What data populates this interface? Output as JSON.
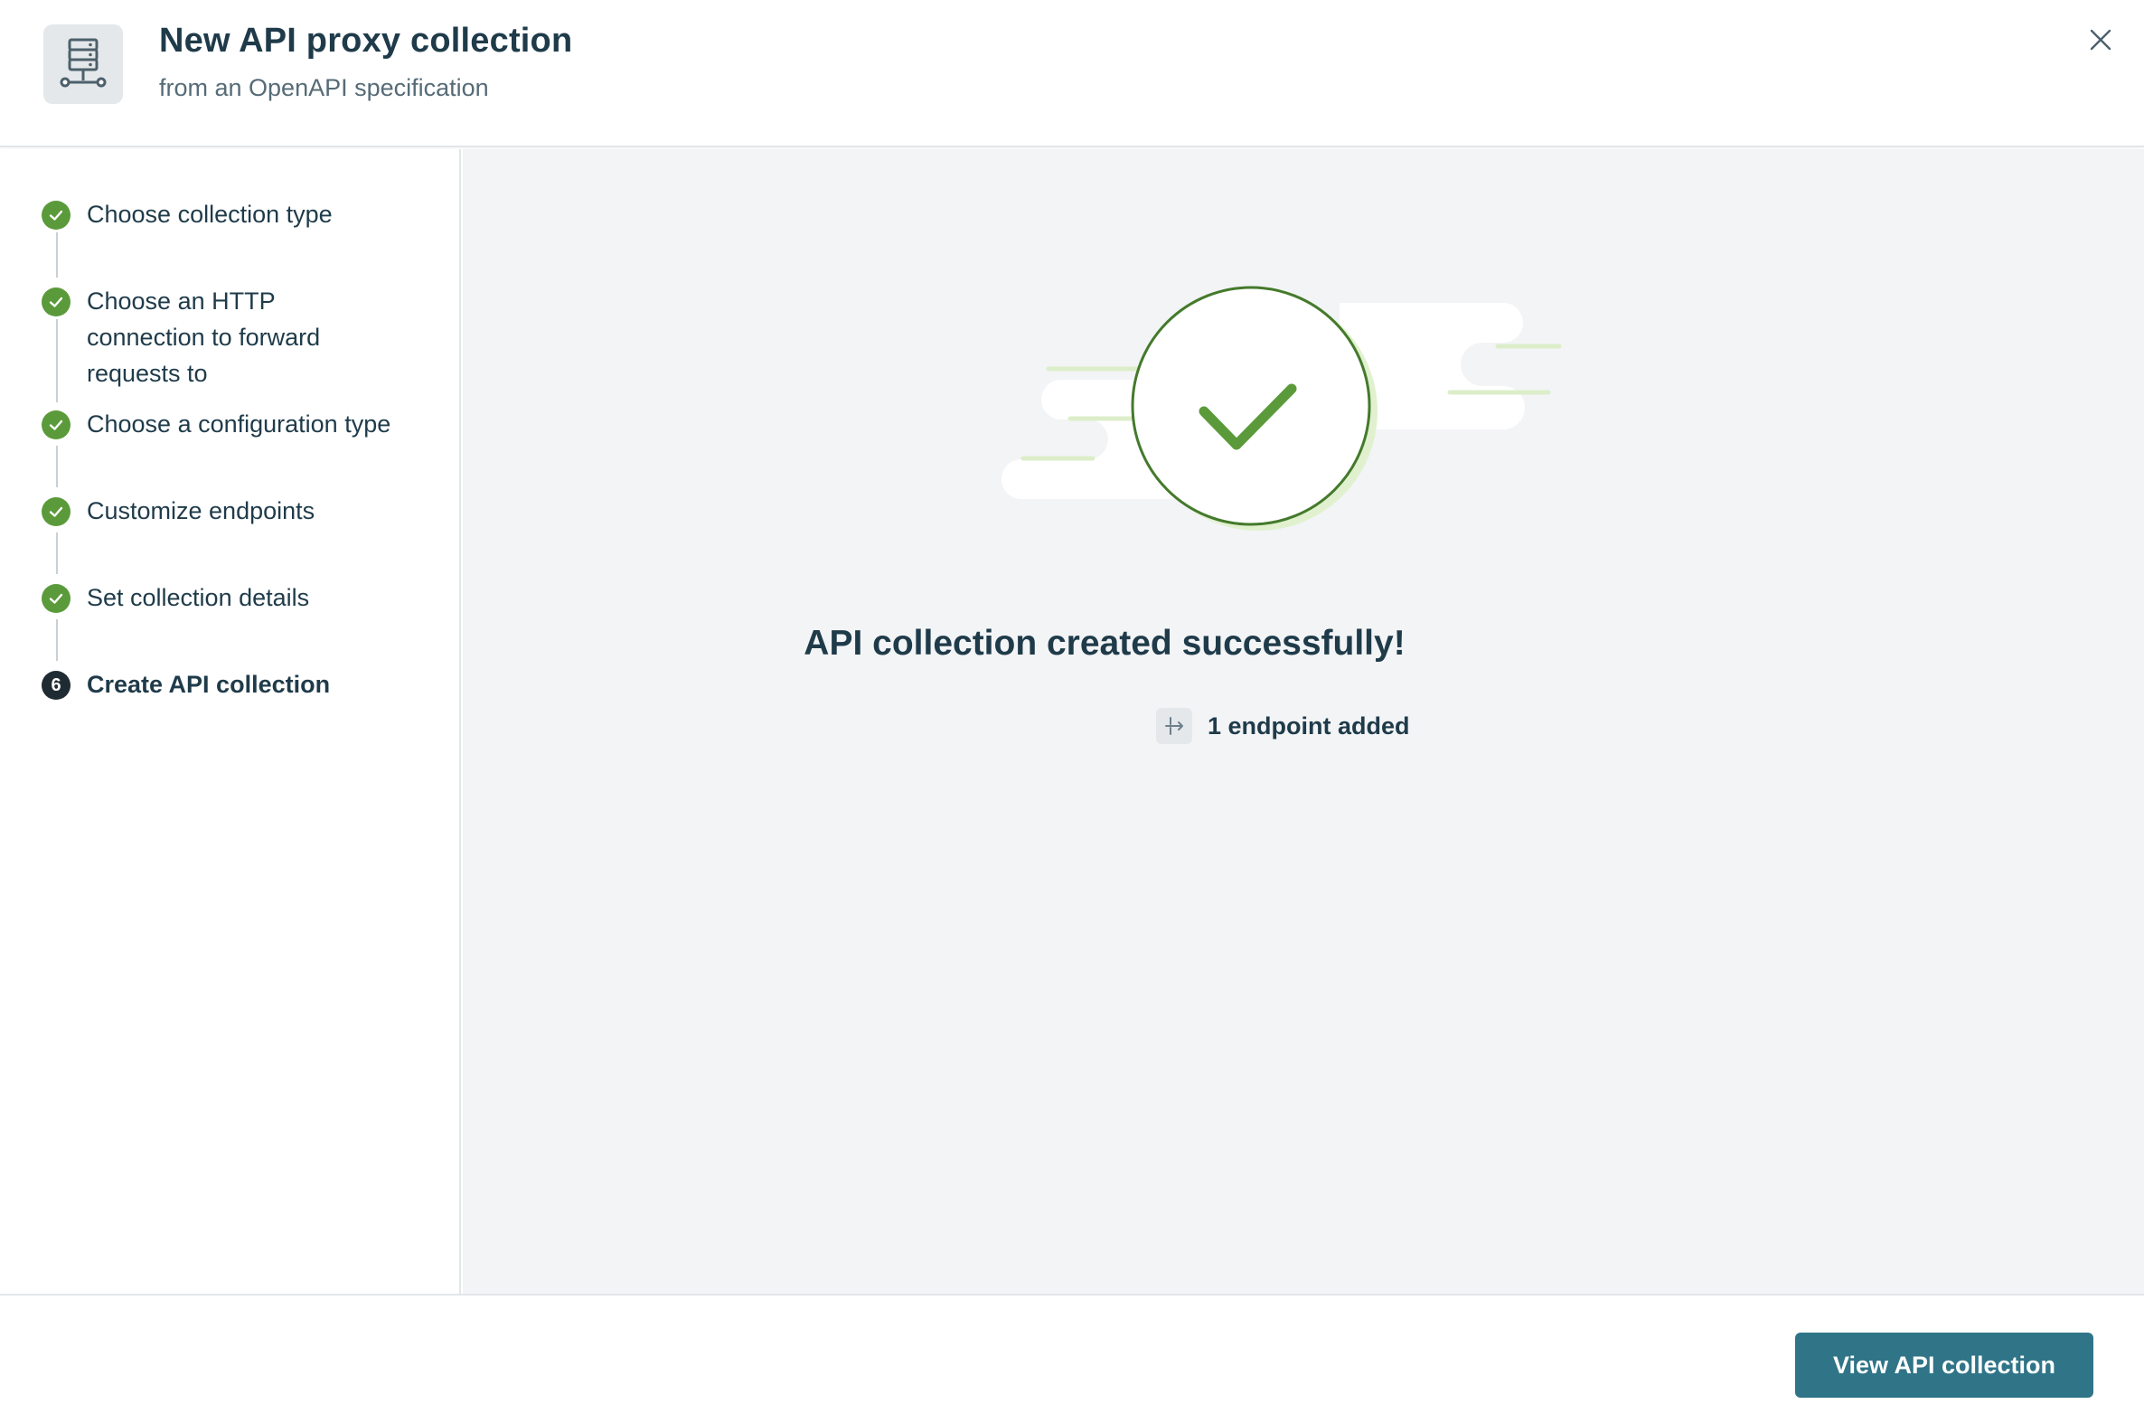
{
  "header": {
    "title": "New API proxy collection",
    "subtitle": "from an OpenAPI specification",
    "icon": "server-network-icon",
    "close_icon": "close-icon"
  },
  "steps": [
    {
      "label": "Choose collection type",
      "status": "complete"
    },
    {
      "label": "Choose an HTTP connection to forward requests to",
      "status": "complete"
    },
    {
      "label": "Choose a configuration type",
      "status": "complete"
    },
    {
      "label": "Customize endpoints",
      "status": "complete"
    },
    {
      "label": "Set collection details",
      "status": "complete"
    },
    {
      "label": "Create API collection",
      "status": "current",
      "number": "6"
    }
  ],
  "result": {
    "title": "API collection created successfully!",
    "endpoints_text": "1 endpoint added",
    "illustration_icon": "success-check-icon",
    "endpoints_icon": "endpoint-icon"
  },
  "footer": {
    "primary_label": "View API collection"
  },
  "colors": {
    "accent": "#2f7487",
    "success": "#5b9a3a",
    "text": "#1f3b4a",
    "muted_text": "#566b77",
    "main_background": "#f3f4f6"
  }
}
